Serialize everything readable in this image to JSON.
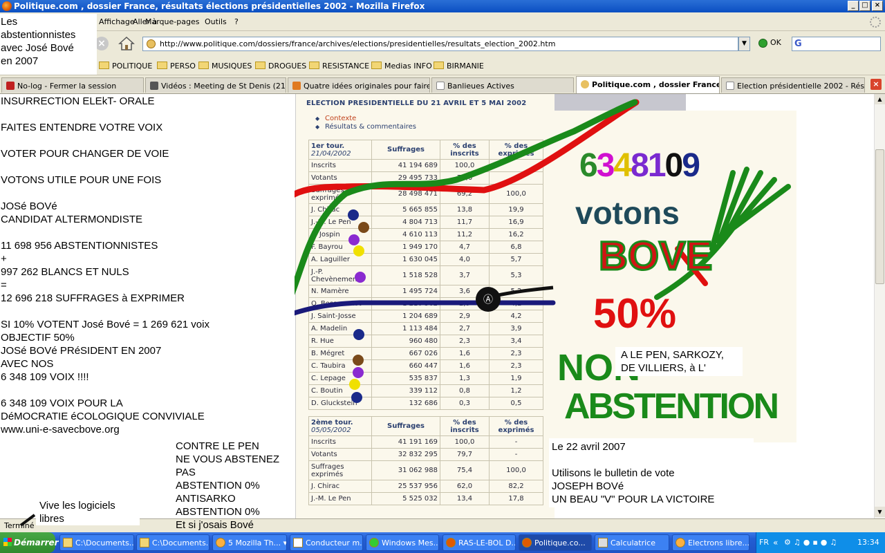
{
  "window": {
    "title": "Politique.com , dossier France, résultats élections présidentielles 2002 - Mozilla Firefox"
  },
  "menu": [
    "Fichier",
    "Édition",
    "Affichage",
    "Aller à",
    "Marque-pages",
    "Outils",
    "?"
  ],
  "nav": {
    "url": "http://www.politique.com/dossiers/france/archives/elections/presidentielles/resultats_election_2002.htm",
    "go_label": "OK"
  },
  "bookmarks": [
    "POLITIQUE",
    "PERSO",
    "MUSIQUES",
    "DROGUES",
    "RESISTANCE",
    "Medias INFO",
    "BIRMANIE"
  ],
  "tabs": [
    "No-log - Fermer la session",
    "Vidéos : Meeting de St Denis (21 f...",
    "Quatre idées originales pour faire ...",
    "Banlieues Actives",
    "Politique.com , dossier France...",
    "Election présidentielle 2002 - Résu..."
  ],
  "panel": {
    "title": "ELECTION PRESIDENTIELLE DU 21 AVRIL ET 5 MAI 2002",
    "links": [
      "Contexte",
      "Résultats & commentaires"
    ],
    "t1_header": {
      "tour": "1er tour.",
      "date": "21/04/2002",
      "c1": "Suffrages",
      "c2a": "% des",
      "c2b": "inscrits",
      "c3a": "% des",
      "c3b": "exprimés"
    },
    "t1_rows": [
      [
        "Inscrits",
        "41 194 689",
        "100,0",
        ""
      ],
      [
        "Votants",
        "29 495 733",
        "71,6",
        ""
      ],
      [
        "Suffrages exprimés",
        "28 498 471",
        "69,2",
        "100,0"
      ],
      [
        "J. Chirac",
        "5 665 855",
        "13,8",
        "19,9"
      ],
      [
        "J.-M. Le Pen",
        "4 804 713",
        "11,7",
        "16,9"
      ],
      [
        "L. Jospin",
        "4 610 113",
        "11,2",
        "16,2"
      ],
      [
        "F. Bayrou",
        "1 949 170",
        "4,7",
        "6,8"
      ],
      [
        "A. Laguiller",
        "1 630 045",
        "4,0",
        "5,7"
      ],
      [
        "J.-P. Chevènement",
        "1 518 528",
        "3,7",
        "5,3"
      ],
      [
        "N. Mamère",
        "1 495 724",
        "3,6",
        "5,2"
      ],
      [
        "O. Besancenot",
        "1 210 562",
        "2,9",
        "4,2"
      ],
      [
        "J. Saint-Josse",
        "1 204 689",
        "2,9",
        "4,2"
      ],
      [
        "A. Madelin",
        "1 113 484",
        "2,7",
        "3,9"
      ],
      [
        "R. Hue",
        "960 480",
        "2,3",
        "3,4"
      ],
      [
        "B. Mégret",
        "667 026",
        "1,6",
        "2,3"
      ],
      [
        "C. Taubira",
        "660 447",
        "1,6",
        "2,3"
      ],
      [
        "C. Lepage",
        "535 837",
        "1,3",
        "1,9"
      ],
      [
        "C. Boutin",
        "339 112",
        "0,8",
        "1,2"
      ],
      [
        "D. Gluckstein",
        "132 686",
        "0,3",
        "0,5"
      ]
    ],
    "t2_header": {
      "tour": "2ème tour.",
      "date": "05/05/2002",
      "c1": "Suffrages",
      "c2a": "% des",
      "c2b": "inscrits",
      "c3a": "% des",
      "c3b": "exprimés"
    },
    "t2_rows": [
      [
        "Inscrits",
        "41 191 169",
        "100,0",
        "-"
      ],
      [
        "Votants",
        "32 832 295",
        "79,7",
        "-"
      ],
      [
        "Suffrages exprimés",
        "31 062 988",
        "75,4",
        "100,0"
      ],
      [
        "J. Chirac",
        "25 537 956",
        "62,0",
        "82,2"
      ],
      [
        "J.-M. Le Pen",
        "5 525 032",
        "13,4",
        "17,8"
      ]
    ]
  },
  "overlay": {
    "corner": "Les\nabstentionnistes\navec José Bové\nen 2007",
    "left_main": "INSURRECTION ELEkT- ORALE\n\nFAITES ENTENDRE VOTRE VOIX\n\nVOTER POUR CHANGER DE VOIE\n\nVOTONS UTILE POUR UNE FOIS\n\nJOSé BOVé\nCANDIDAT ALTERMONDISTE\n\n11 698 956 ABSTENTIONNISTES\n+\n997 262 BLANCS ET NULS\n=\n12 696 218 SUFFRAGES à EXPRIMER\n\nSI 10% VOTENT José Bové = 1 269 621 voix\nOBJECTIF 50%\nJOSé BOVé PRéSIDENT EN 2007\nAVEC NOS\n6 348 109 VOIX !!!!\n\n6 348 109 VOIX POUR LA\nDéMOCRATIE éCOLOGIQUE CONVIVIALE\nwww.uni-e-savecbove.org",
    "contre": "CONTRE LE PEN\nNE VOUS ABSTENEZ\nPAS\nABSTENTION 0%\nANTISARKO\nABSTENTION 0%\nEt si j'osais Bové",
    "logiciels": "Vive les logiciels\nlibres",
    "le_pen_box": "A LE PEN, SARKOZY,\nDE VILLIERS, à L'",
    "date_box": "Le 22 avril 2007\n\nUtilisons le bulletin de vote\nJOSEPH BOVé\nUN BEAU \"V\" POUR LA VICTOIRE",
    "paint_number": "6348109",
    "paint_votons": "votons",
    "paint_bove": "BOVE",
    "paint_pct": "50%",
    "paint_non": "NON",
    "paint_abst": "ABSTENTION"
  },
  "status": "Terminé",
  "taskbar": {
    "start": "Démarrer",
    "items": [
      "C:\\Documents...",
      "C:\\Documents...",
      "5 Mozilla Th...",
      "Conducteur m...",
      "Windows Mes...",
      "RAS-LE-BOL D...",
      "Politique.co...",
      "Calculatrice",
      "Electrons libre..."
    ],
    "lang": "FR",
    "clock": "13:34"
  }
}
